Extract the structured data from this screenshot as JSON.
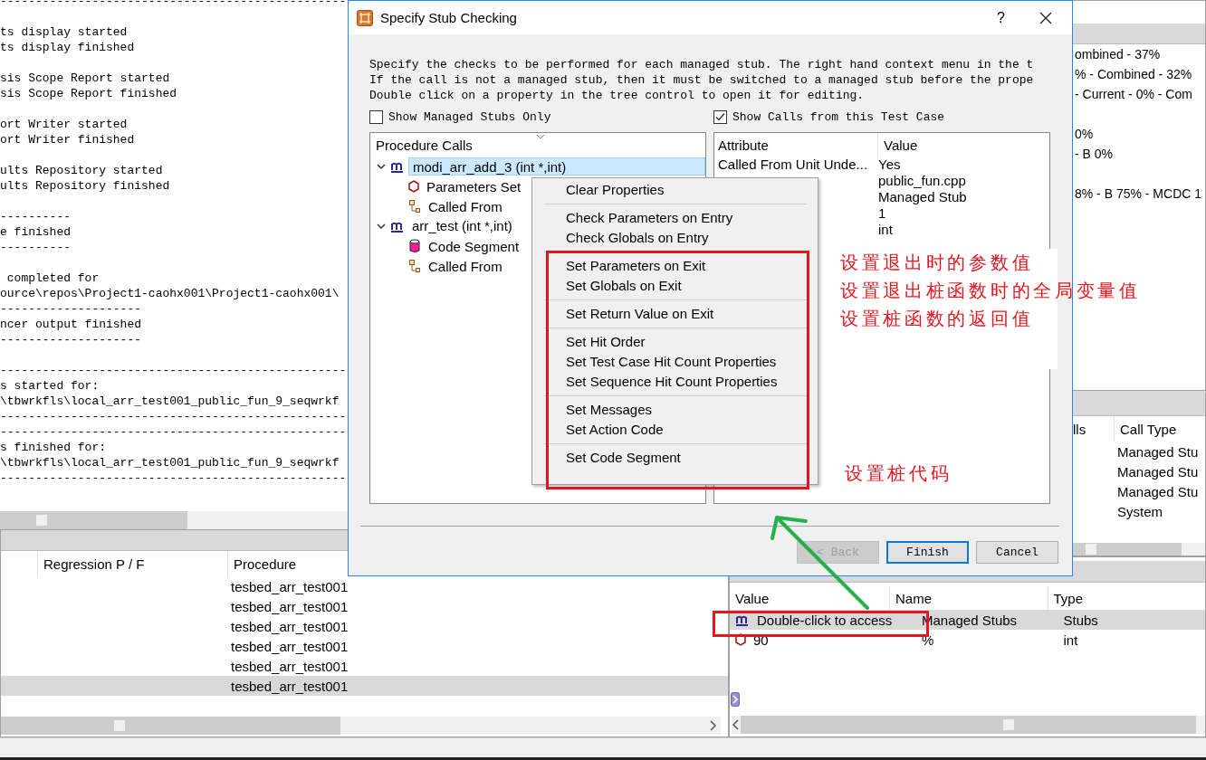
{
  "log": {
    "groups": [
      [
        "-------------------------------------------------"
      ],
      [
        "ts display started",
        "ts display finished"
      ],
      [
        "sis Scope Report started",
        "sis Scope Report finished"
      ],
      [
        "ort Writer started",
        "ort Writer finished"
      ],
      [
        "ults Repository started",
        "ults Repository finished"
      ],
      [
        "----------",
        "e finished",
        "----------"
      ],
      [
        " completed for",
        "ource\\repos\\Project1-caohx001\\Project1-caohx001\\",
        "--------------------",
        "ncer output finished",
        "--------------------"
      ],
      [
        "-------------------------------------------------",
        "s started for:",
        "\\tbwrkfls\\local_arr_test001_public_fun_9_seqwrkf",
        "-------------------------------------------------",
        "-------------------------------------------------",
        "s finished for:",
        "\\tbwrkfls\\local_arr_test001_public_fun_9_seqwrkf",
        "-------------------------------------------------"
      ]
    ]
  },
  "coverage_panel": {
    "groups": [
      [
        "ombined - 37%",
        "% - Combined - 32%",
        "- Current - 0% - Com"
      ],
      [
        "0%",
        "- B 0%"
      ],
      [
        "8% - B 75% - MCDC 1"
      ]
    ]
  },
  "calls_panel": {
    "columns": [
      "lls",
      "Call Type"
    ],
    "rows": [
      {
        "call_type": "Managed Stu"
      },
      {
        "call_type": "Managed Stu"
      },
      {
        "call_type": "Managed Stu"
      },
      {
        "call_type": "System"
      }
    ]
  },
  "results_table": {
    "columns": [
      "Regression P / F",
      "Procedure"
    ],
    "rows": [
      {
        "procedure": "tesbed_arr_test001",
        "selected": false
      },
      {
        "procedure": "tesbed_arr_test001",
        "selected": false
      },
      {
        "procedure": "tesbed_arr_test001",
        "selected": false
      },
      {
        "procedure": "tesbed_arr_test001",
        "selected": false
      },
      {
        "procedure": "tesbed_arr_test001",
        "selected": false
      },
      {
        "procedure": "tesbed_arr_test001",
        "selected": true
      }
    ]
  },
  "attributes_table": {
    "columns": [
      "Value",
      "Name",
      "Type"
    ],
    "rows": [
      {
        "kind": "stub",
        "value": "Double-click to access",
        "name": "Managed Stubs",
        "type": "Stubs",
        "selected": true
      },
      {
        "kind": "parameter",
        "value": "90",
        "name": "%",
        "type": "int",
        "selected": false
      }
    ]
  },
  "dialog": {
    "title": "Specify Stub Checking",
    "help": "?",
    "description": [
      "Specify the checks to be performed for each managed stub. The right hand context menu in the t",
      "If the call is not a managed stub, then it must be switched to a managed stub before the prope",
      "Double click on a property in the tree control to open it for editing."
    ],
    "checkboxes": [
      {
        "label": "Show Managed Stubs Only",
        "checked": false
      },
      {
        "label": "Show Calls from this Test Case",
        "checked": true
      }
    ],
    "tree": {
      "heading": "Procedure Calls",
      "items": [
        {
          "kind": "stub",
          "label": "modi_arr_add_3 (int *,int)",
          "selected": true,
          "expanded": true,
          "children": [
            {
              "kind": "parameters",
              "label": "Parameters Set"
            },
            {
              "kind": "called_from",
              "label": "Called From"
            }
          ]
        },
        {
          "kind": "stub",
          "label": "arr_test (int *,int)",
          "selected": false,
          "expanded": true,
          "children": [
            {
              "kind": "code_segment",
              "label": "Code Segment"
            },
            {
              "kind": "called_from",
              "label": "Called From"
            }
          ]
        }
      ]
    },
    "properties": {
      "columns": [
        "Attribute",
        "Value"
      ],
      "rows": [
        {
          "attribute": "Called From Unit Unde...",
          "value": "Yes"
        },
        {
          "value": "public_fun.cpp"
        },
        {
          "value": "Managed Stub"
        },
        {
          "value": "1"
        },
        {
          "value": "int"
        }
      ]
    },
    "buttons": [
      {
        "label": "< Back",
        "disabled": true,
        "default": false
      },
      {
        "label": "Finish",
        "disabled": false,
        "default": true
      },
      {
        "label": "Cancel",
        "disabled": false,
        "default": false
      }
    ]
  },
  "context_menu": {
    "groups": [
      [
        "Clear Properties"
      ],
      [
        "Check Parameters on Entry",
        "Check Globals on Entry"
      ],
      [
        "Set Parameters on Exit",
        "Set Globals on Exit"
      ],
      [
        "Set Return Value on Exit"
      ],
      [
        "Set Hit Order",
        "Set Test Case Hit Count Properties",
        "Set Sequence Hit Count Properties"
      ],
      [
        "Set Messages",
        "Set Action Code"
      ],
      [
        "Set Code Segment"
      ]
    ]
  },
  "annotations": {
    "notes": [
      "设置退出时的参数值",
      "设置退出桩函数时的全局变量值",
      "设置桩函数的返回值"
    ],
    "code_note": "设置桩代码"
  }
}
